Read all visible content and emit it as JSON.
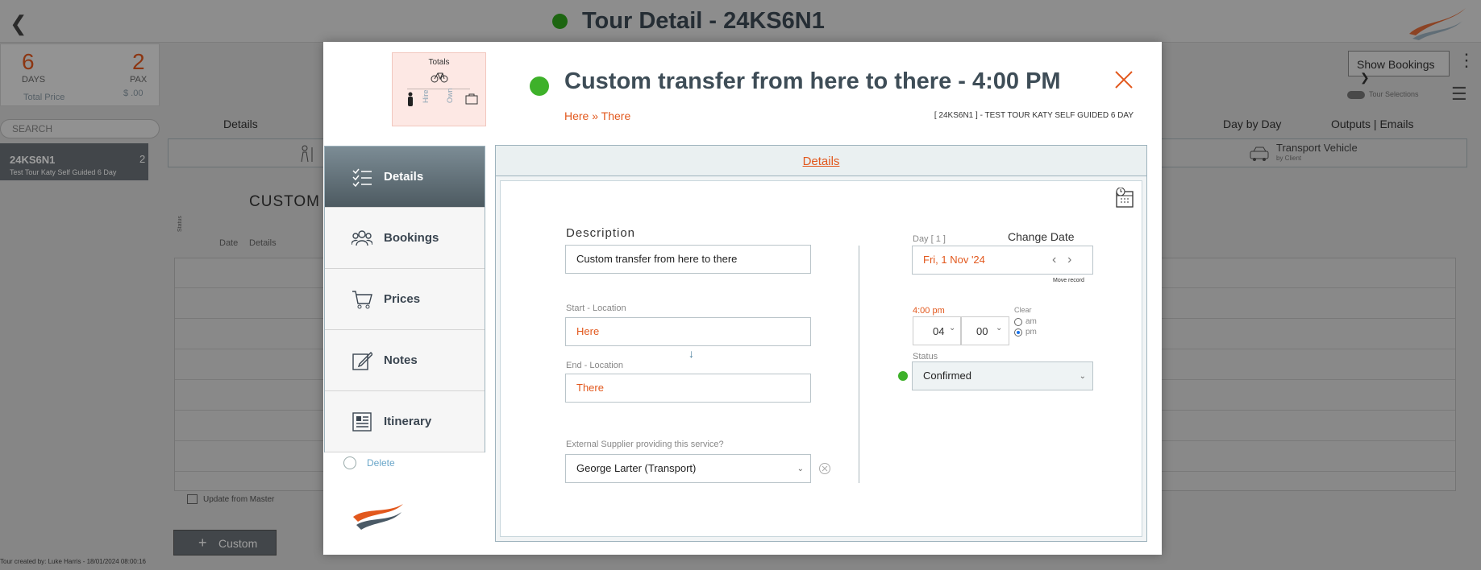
{
  "header": {
    "title": "Tour Detail - 24KS6N1",
    "status_color": "#2fa31c"
  },
  "stats": {
    "days_value": "6",
    "days_label": "DAYS",
    "pax_value": "2",
    "pax_label": "PAX",
    "total_price_label": "Total Price",
    "total_price_value": "$ .00"
  },
  "search": {
    "placeholder": "SEARCH"
  },
  "tour_list": [
    {
      "code": "24KS6N1",
      "name": "Test Tour Katy Self Guided 6 Day",
      "pax": "2"
    }
  ],
  "bg_tabs": {
    "details": "Details",
    "day_by_day": "Day by Day",
    "outputs": "Outputs | Emails"
  },
  "bg_transport": {
    "title": "Transport Vehicle",
    "sub": "by Client"
  },
  "bg_custom_heading": "CUSTOM",
  "bg_columns": {
    "status": "Status",
    "date": "Date",
    "details": "Details"
  },
  "bg_update_master": "Update from Master",
  "bg_custom_button": "Custom",
  "bg_footer": "Tour created by: Luke Harris - 18/01/2024 08:00:16",
  "bg_show_bookings": "Show Bookings",
  "bg_tour_selections": "Tour Selections",
  "modal": {
    "totals": {
      "label": "Totals",
      "hire_label": "Hire",
      "own_label": "Own"
    },
    "title": "Custom transfer from here to there  - 4:00 PM",
    "route": "Here » There",
    "tour_ref": "[ 24KS6N1 ] - TEST TOUR KATY SELF GUIDED 6 DAY",
    "status_color": "#3eb12a",
    "nav": [
      {
        "label": "Details",
        "icon": "details-list-icon",
        "active": true
      },
      {
        "label": "Bookings",
        "icon": "people-group-icon",
        "active": false
      },
      {
        "label": "Prices",
        "icon": "shopping-cart-icon",
        "active": false
      },
      {
        "label": "Notes",
        "icon": "edit-note-icon",
        "active": false
      },
      {
        "label": "Itinerary",
        "icon": "newspaper-icon",
        "active": false
      }
    ],
    "delete_label": "Delete",
    "details_header": "Details",
    "form": {
      "description_label": "Description",
      "description_value": "Custom transfer from here to there",
      "start_label": "Start - Location",
      "start_value": "Here",
      "end_label": "End - Location",
      "end_value": "There",
      "supplier_label": "External Supplier providing this service?",
      "supplier_value": "George Larter (Transport)",
      "day_label": "Day [ 1 ]",
      "change_date_label": "Change Date",
      "date_value": "Fri, 1 Nov '24",
      "move_record_label": "Move record",
      "time_value": "4:00 pm",
      "clear_label": "Clear",
      "hour_value": "04",
      "minute_value": "00",
      "am_label": "am",
      "pm_label": "pm",
      "status_label": "Status",
      "status_value": "Confirmed"
    }
  }
}
